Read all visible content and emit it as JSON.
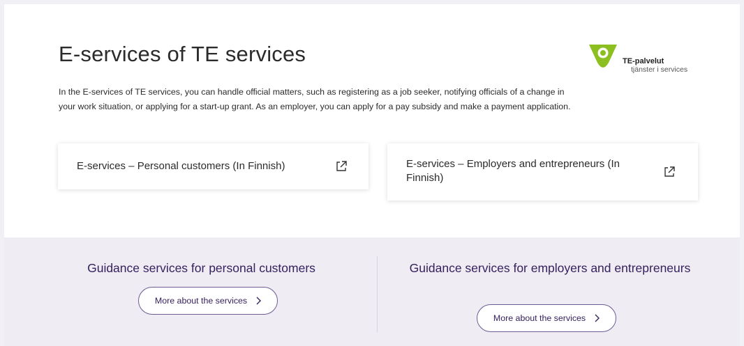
{
  "page": {
    "title": "E-services of TE services",
    "intro": "In the E-services of TE services, you can handle official matters, such as registering as a job seeker, notifying officials of a change in your work situation, or applying for a start-up grant. As an employer, you can apply for a pay subsidy and make a payment application."
  },
  "logo": {
    "title": "TE-palvelut",
    "subtitle": "tjänster i services",
    "colors": {
      "green": "#8cbf1f",
      "purple": "#3b1a6b"
    }
  },
  "cards": [
    {
      "label": "E-services – Personal customers (In Finnish)",
      "icon": "external-link-icon"
    },
    {
      "label": "E-services – Employers and entrepreneurs (In Finnish)",
      "icon": "external-link-icon"
    }
  ],
  "guidance": [
    {
      "title": "Guidance services for personal customers",
      "button": "More about the services",
      "icon": "chevron-right-icon"
    },
    {
      "title": "Guidance services for employers and entrepreneurs",
      "button": "More about the services",
      "icon": "chevron-right-icon"
    }
  ],
  "colors": {
    "accent": "#35215e",
    "band_background": "#efedf3",
    "card_background": "#ffffff"
  }
}
